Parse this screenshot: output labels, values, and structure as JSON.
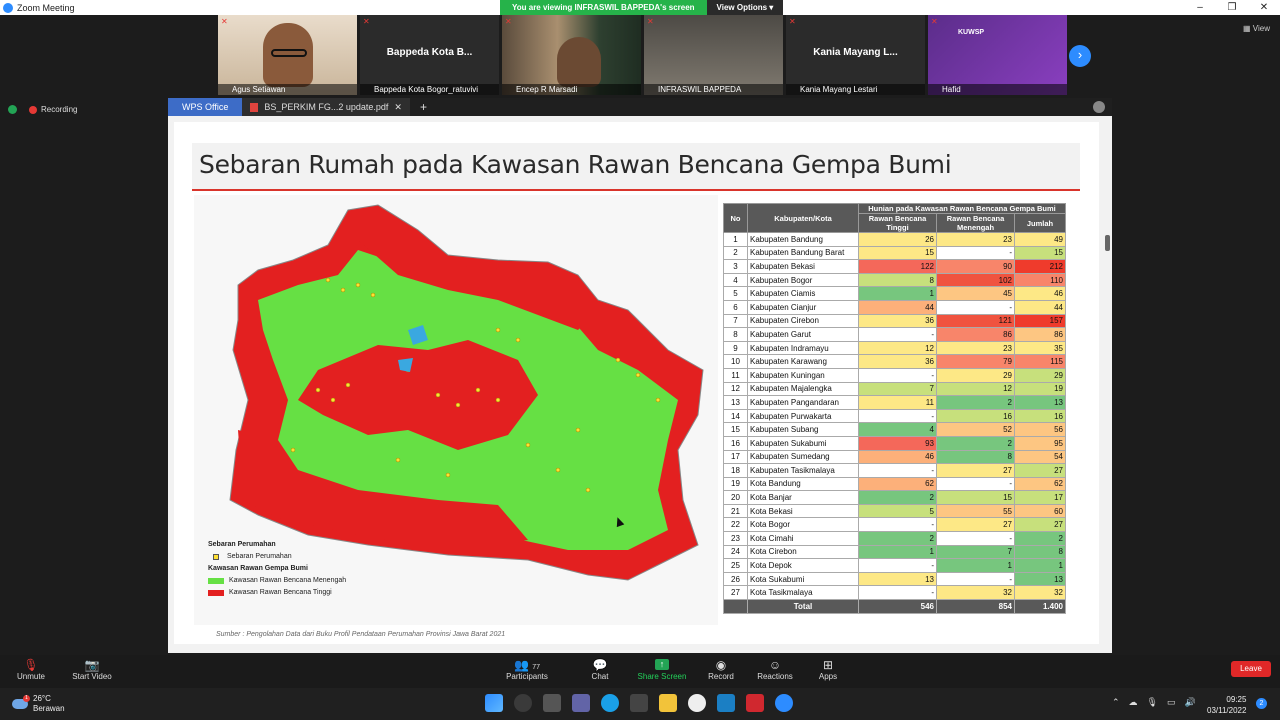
{
  "window": {
    "title": "Zoom Meeting"
  },
  "share_banner": {
    "message": "You are viewing INFRASWIL BAPPEDA's screen",
    "options": "View Options ▾"
  },
  "gallery": [
    {
      "name": "Agus Setiawan",
      "type": "video"
    },
    {
      "name": "Bappeda Kota Bogor_ratuvivi",
      "big_label": "Bappeda Kota B...",
      "type": "text"
    },
    {
      "name": "Encep R Marsadi",
      "type": "video"
    },
    {
      "name": "INFRASWIL BAPPEDA",
      "type": "video"
    },
    {
      "name": "Kania Mayang Lestari",
      "big_label": "Kania Mayang L...",
      "type": "text"
    },
    {
      "name": "Hafid",
      "type": "video",
      "brand": "KUWSP"
    }
  ],
  "view_label": "View",
  "recording_label": "Recording",
  "wps": {
    "app_tab": "WPS Office",
    "doc_tab": "BS_PERKIM FG...2 update.pdf"
  },
  "slide": {
    "title": "Sebaran Rumah pada Kawasan Rawan Bencana Gempa Bumi",
    "legend": {
      "housing_heading": "Sebaran Perumahan",
      "housing_item": "Sebaran Perumahan",
      "hazard_heading": "Kawasan Rawan Gempa Bumi",
      "medium_item": "Kawasan Rawan Bencana Menengah",
      "high_item": "Kawasan Rawan Bencana Tinggi",
      "medium_color": "#66e044",
      "high_color": "#e32020"
    },
    "source": "Sumber : Pengolahan Data dari Buku Profil Pendataan Perumahan Provinsi Jawa Barat 2021",
    "table": {
      "h_no": "No",
      "h_kab": "Kabupaten/Kota",
      "h_group": "Hunian pada Kawasan Rawan Bencana Gempa Bumi",
      "h_tinggi": "Rawan Bencana Tinggi",
      "h_menengah": "Rawan Bencana Menengah",
      "h_jumlah": "Jumlah",
      "rows": [
        [
          "1",
          "Kabupaten Bandung",
          "26",
          "23",
          "49"
        ],
        [
          "2",
          "Kabupaten Bandung Barat",
          "15",
          "-",
          "15"
        ],
        [
          "3",
          "Kabupaten Bekasi",
          "122",
          "90",
          "212"
        ],
        [
          "4",
          "Kabupaten Bogor",
          "8",
          "102",
          "110"
        ],
        [
          "5",
          "Kabupaten Ciamis",
          "1",
          "45",
          "46"
        ],
        [
          "6",
          "Kabupaten Cianjur",
          "44",
          "-",
          "44"
        ],
        [
          "7",
          "Kabupaten Cirebon",
          "36",
          "121",
          "157"
        ],
        [
          "8",
          "Kabupaten Garut",
          "-",
          "86",
          "86"
        ],
        [
          "9",
          "Kabupaten Indramayu",
          "12",
          "23",
          "35"
        ],
        [
          "10",
          "Kabupaten Karawang",
          "36",
          "79",
          "115"
        ],
        [
          "11",
          "Kabupaten Kuningan",
          "-",
          "29",
          "29"
        ],
        [
          "12",
          "Kabupaten Majalengka",
          "7",
          "12",
          "19"
        ],
        [
          "13",
          "Kabupaten Pangandaran",
          "11",
          "2",
          "13"
        ],
        [
          "14",
          "Kabupaten Purwakarta",
          "-",
          "16",
          "16"
        ],
        [
          "15",
          "Kabupaten Subang",
          "4",
          "52",
          "56"
        ],
        [
          "16",
          "Kabupaten Sukabumi",
          "93",
          "2",
          "95"
        ],
        [
          "17",
          "Kabupaten Sumedang",
          "46",
          "8",
          "54"
        ],
        [
          "18",
          "Kabupaten Tasikmalaya",
          "-",
          "27",
          "27"
        ],
        [
          "19",
          "Kota Bandung",
          "62",
          "-",
          "62"
        ],
        [
          "20",
          "Kota Banjar",
          "2",
          "15",
          "17"
        ],
        [
          "21",
          "Kota Bekasi",
          "5",
          "55",
          "60"
        ],
        [
          "22",
          "Kota Bogor",
          "-",
          "27",
          "27"
        ],
        [
          "23",
          "Kota Cimahi",
          "2",
          "-",
          "2"
        ],
        [
          "24",
          "Kota Cirebon",
          "1",
          "7",
          "8"
        ],
        [
          "25",
          "Kota Depok",
          "-",
          "1",
          "1"
        ],
        [
          "26",
          "Kota Sukabumi",
          "13",
          "-",
          "13"
        ],
        [
          "27",
          "Kota Tasikmalaya",
          "-",
          "32",
          "32"
        ]
      ],
      "total": [
        "Total",
        "546",
        "854",
        "1.400"
      ]
    }
  },
  "controls": {
    "unmute": "Unmute",
    "start_video": "Start Video",
    "participants": "Participants",
    "participants_count": "77",
    "chat": "Chat",
    "share": "Share Screen",
    "record": "Record",
    "reactions": "Reactions",
    "apps": "Apps",
    "leave": "Leave"
  },
  "taskbar": {
    "temp": "26°C",
    "weather": "Berawan",
    "weather_badge": "1",
    "time": "09:25",
    "date": "03/11/2022",
    "notif_count": "2"
  }
}
